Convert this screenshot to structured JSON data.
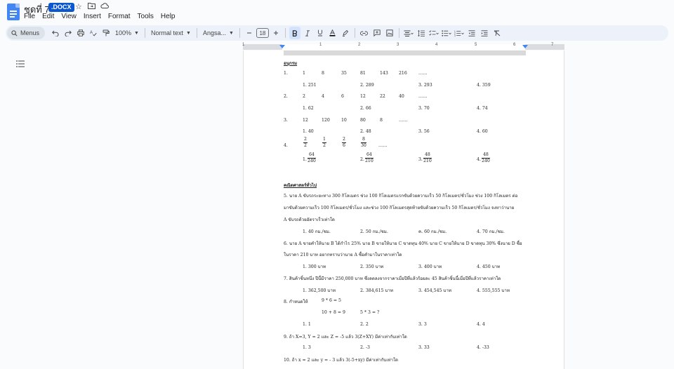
{
  "window": {
    "title": "ชุดที่ 7",
    "badge": ".DOCX"
  },
  "menu": [
    "File",
    "Edit",
    "View",
    "Insert",
    "Format",
    "Tools",
    "Help"
  ],
  "toolbar": {
    "menus_label": "Menus",
    "zoom": "100%",
    "style": "Normal text",
    "font": "Angsa...",
    "font_size": "18"
  },
  "ruler": {
    "numbers": [
      "1",
      "1",
      "2",
      "3",
      "4",
      "5",
      "6",
      "7"
    ]
  },
  "doc": {
    "section1_heading": "อนุกรม",
    "q1": {
      "no": "1.",
      "terms": [
        "1",
        "8",
        "35",
        "81",
        "143",
        "216",
        "……"
      ],
      "choices": [
        "1. 251",
        "2. 289",
        "3. 293",
        "4. 359"
      ]
    },
    "q2": {
      "no": "2.",
      "terms": [
        "2",
        "4",
        "6",
        "12",
        "22",
        "40",
        "……"
      ],
      "choices": [
        "1. 62",
        "2. 66",
        "3. 70",
        "4. 74"
      ]
    },
    "q3": {
      "no": "3.",
      "terms": [
        "12",
        "120",
        "10",
        "80",
        "8",
        "……"
      ],
      "choices": [
        "1. 40",
        "2. 48",
        "3. 56",
        "4. 60"
      ]
    },
    "q4": {
      "no": "4.",
      "fractions": [
        [
          "2",
          "2"
        ],
        [
          "1",
          "2"
        ],
        [
          "2",
          "6"
        ],
        [
          "8",
          "30"
        ]
      ],
      "dots": "……",
      "choice_prefix": [
        "1.",
        "2.",
        "3.",
        "4."
      ],
      "choice_fracs": [
        [
          "64",
          "240"
        ],
        [
          "64",
          "210"
        ],
        [
          "48",
          "210"
        ],
        [
          "48",
          "240"
        ]
      ]
    },
    "section2_heading": "คณิตศาสตร์ทั่วไป",
    "q5_lines": [
      "5. นาย A ขับรถระยะทาง 300 กิโลเมตร ช่วง 100 กิโลเมตรแรกขับด้วยความเร็ว 50 กิโลเมตร/ชั่วโมง ช่วง 100 กิโลเมตร ต่อ",
      "มาขับด้วยความเร็ว 100 กิโลเมตร/ชั่วโมง และช่วง 100 กิโลเมตรสุดท้ายขับด้วยความเร็ว 50 กิโลเมตร/ชั่วโมง จงหาว่านาย",
      "A ขับรถด้วยอัตราเร็วเท่าใด"
    ],
    "q5_choices": [
      "1. 40 กม./ชม.",
      "2. 50 กม./ชม.",
      "ค. 60 กม./ชม.",
      "4. 70 กม./ชม."
    ],
    "q6_lines": [
      "6. นาย A ขายคำให้นาย B ได้กำไร 25% นาย B ขายให้นาย C ขาดทุน 40% นาย C ขายให้นาย D ขาดทุน 30% ซึ่งนาย D ซื้อ",
      "ในราคา 210 บาท อยากทราบว่านาย A ซื้อคำมาในราคาเท่าใด"
    ],
    "q6_choices": [
      "1. 300 บาท",
      "2. 350 บาท",
      "3. 400 บาท",
      "4. 450 บาท"
    ],
    "q7_line": "7. สินค้าชิ้นหนึ่ง ปีนี้มีราคา 250,000 บาท ซึ่งลดลงจากราคาเมื่อปีที่แล้วร้อยละ 45 สินค้าชิ้นนี้เมื่อปีที่แล้วราคาเท่าใด",
    "q7_choices": [
      "1. 362,500 บาท",
      "2. 384,615 บาท",
      "3. 454,545 บาท",
      "4. 555,555 บาท"
    ],
    "q8_line1_a": "8. กำหนดให้",
    "q8_line1_b": "9 * 6 = 5",
    "q8_line2_a": "10 + 8 = 9",
    "q8_line2_b": "5 * 3 = ?",
    "q8_choices": [
      "1. 1",
      "2. 2",
      "3. 3",
      "4. 4"
    ],
    "q9_line": "9. ถ้า X=3, Y = 2 และ Z = -5 แล้ว 3(Z+XY) มีค่าเท่ากับเท่าใด",
    "q9_choices": [
      "1. 3",
      "2. -3",
      "3. 33",
      "4. -33"
    ],
    "q10_line": "10. ถ้า x = 2 และ y = - 3 แล้ว 3(-5+xy) มีค่าเท่ากับเท่าใด"
  }
}
